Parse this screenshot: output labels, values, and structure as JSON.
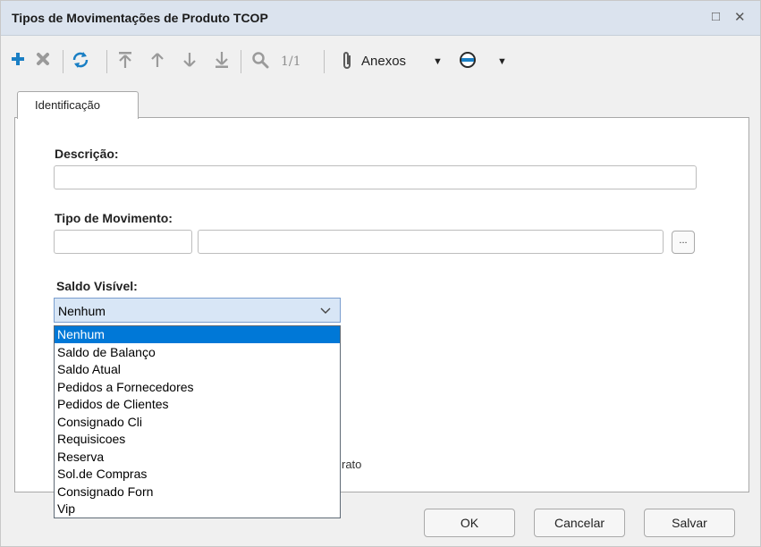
{
  "window": {
    "title": "Tipos de Movimentações de Produto TCOP",
    "restore_icon": "□",
    "close_icon": "✕"
  },
  "toolbar": {
    "record_counter": "1/1",
    "attachments_label": "Anexos",
    "dropdown_arrow": "▼",
    "icons": [
      "plus-icon",
      "delete-icon",
      "refresh-icon",
      "first-record-icon",
      "previous-record-icon",
      "next-record-icon",
      "last-record-icon",
      "search-icon",
      "paperclip-icon",
      "options-icon"
    ],
    "colors": {
      "plus": "#1a7fc4",
      "refresh": "#1a7fc4",
      "disabled": "#9a9a9a",
      "delete": "#9a9a9a"
    }
  },
  "tabs": [
    {
      "label": "Identificação",
      "active": true
    }
  ],
  "form": {
    "descricao_label": "Descrição:",
    "descricao_value": "",
    "tipo_movimento_label": "Tipo de Movimento:",
    "tipo_movimento_code": "",
    "tipo_movimento_desc": "",
    "lookup_button": "...",
    "saldo_visivel_label": "Saldo Visível:",
    "saldo_visivel_value": "Nenhum",
    "saldo_visivel_options": [
      "Nenhum",
      "Saldo de Balanço",
      "Saldo Atual",
      "Pedidos a Fornecedores",
      "Pedidos de Clientes",
      "Consignado Cli",
      "Requisicoes",
      "Reserva",
      "Sol.de Compras",
      "Consignado Forn",
      "Vip"
    ],
    "partially_hidden_text": "rato"
  },
  "buttons": {
    "ok": "OK",
    "cancel": "Cancelar",
    "save": "Salvar"
  },
  "colors": {
    "titlebar": "#dbe3ee",
    "selection": "#0078d7",
    "select_bg": "#d8e6f6"
  }
}
